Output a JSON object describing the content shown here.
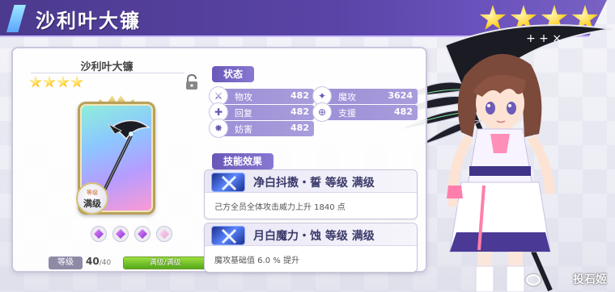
{
  "header": {
    "title": "沙利叶大镰",
    "star_count": 4
  },
  "weapon": {
    "name": "沙利叶大镰",
    "rarity_stars": 4,
    "badge_top": "等级",
    "badge_main": "满级",
    "gems_filled": 3,
    "gems_total": 4,
    "level_label": "等级",
    "level_current": "40",
    "level_max": "/40",
    "level_bar_text": "满级/满级",
    "level_progress": 1.0
  },
  "stats": {
    "header": "状态",
    "rows": [
      {
        "icon": "sword-icon",
        "name": "物攻",
        "value": "482"
      },
      {
        "icon": "staff-icon",
        "name": "魔攻",
        "value": "3624"
      },
      {
        "icon": "heal-icon",
        "name": "回复",
        "value": "482"
      },
      {
        "icon": "support-icon",
        "name": "支援",
        "value": "482"
      },
      {
        "icon": "hinder-icon",
        "name": "妨害",
        "value": "482"
      }
    ]
  },
  "skills": {
    "header": "技能效果",
    "items": [
      {
        "name": "净白抖擞・誓 等级 满级",
        "desc": "己方全员全体攻击威力上升 1840 点"
      },
      {
        "name": "月白魔力・蚀 等级 满级",
        "desc": "魔攻基础值 6.0 % 提升"
      }
    ]
  },
  "watermark": "投石姬",
  "colors": {
    "title_bar": "#5a44a6",
    "stat_row": "#9c8fd6",
    "accent_gold": "#ffcd1e",
    "level_bar": "#56a81b"
  }
}
